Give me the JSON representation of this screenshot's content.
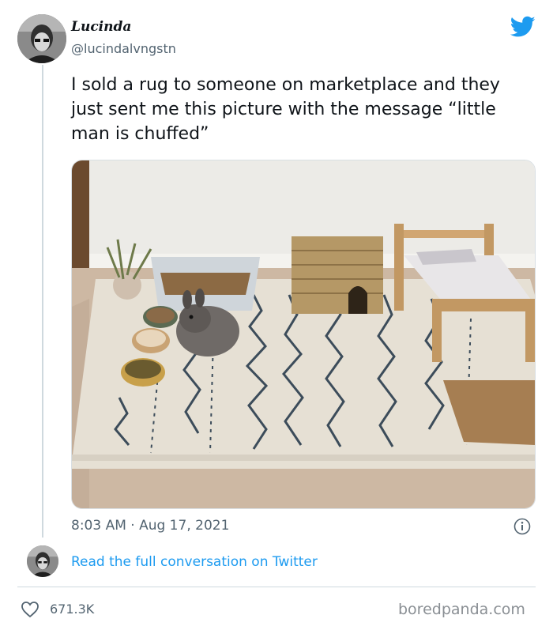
{
  "tweet": {
    "display_name": "Lucinda",
    "handle": "@lucindalvngstn",
    "text": "I sold a rug to someone on marketplace and they just sent me this picture with the message “little man is chuffed”",
    "timestamp": "8:03 AM · Aug 17, 2021",
    "likes": "671.3K",
    "read_more_label": "Read the full conversation on Twitter"
  },
  "icons": {
    "brand": "twitter-bird-icon",
    "info": "info-icon",
    "like": "heart-icon",
    "avatar": "user-avatar",
    "photo": "tweet-photo"
  },
  "colors": {
    "twitter_blue": "#1d9bf0",
    "secondary_text": "#536471",
    "primary_text": "#0f1419",
    "divider": "#cfd9de"
  },
  "watermark": "boredpanda.com"
}
